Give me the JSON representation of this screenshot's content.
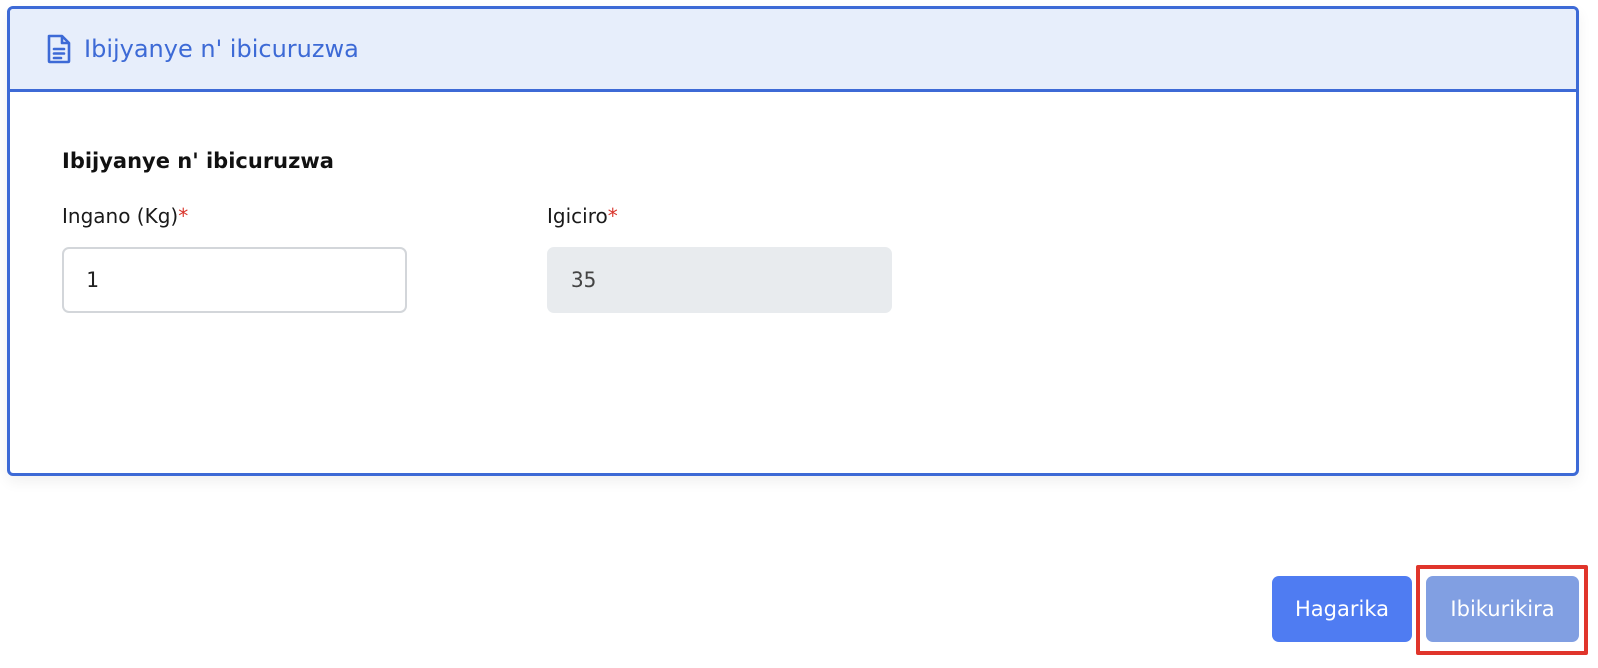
{
  "header": {
    "icon": "document-icon",
    "title": "Ibijyanye n' ibicuruzwa"
  },
  "section": {
    "heading": "Ibijyanye n' ibicuruzwa"
  },
  "fields": {
    "quantity": {
      "label": "Ingano (Kg)",
      "required_mark": "*",
      "value": "1"
    },
    "price": {
      "label": "Igiciro",
      "required_mark": "*",
      "value": "35"
    }
  },
  "actions": {
    "cancel_label": "Hagarika",
    "submit_label": "Ibikurikira"
  },
  "colors": {
    "accent": "#3d6ad6",
    "header_bg": "#e7eefb",
    "cancel_button": "#4f7cf2",
    "submit_button": "#819fe2",
    "required": "#d9342b",
    "highlight": "#e0352b"
  }
}
